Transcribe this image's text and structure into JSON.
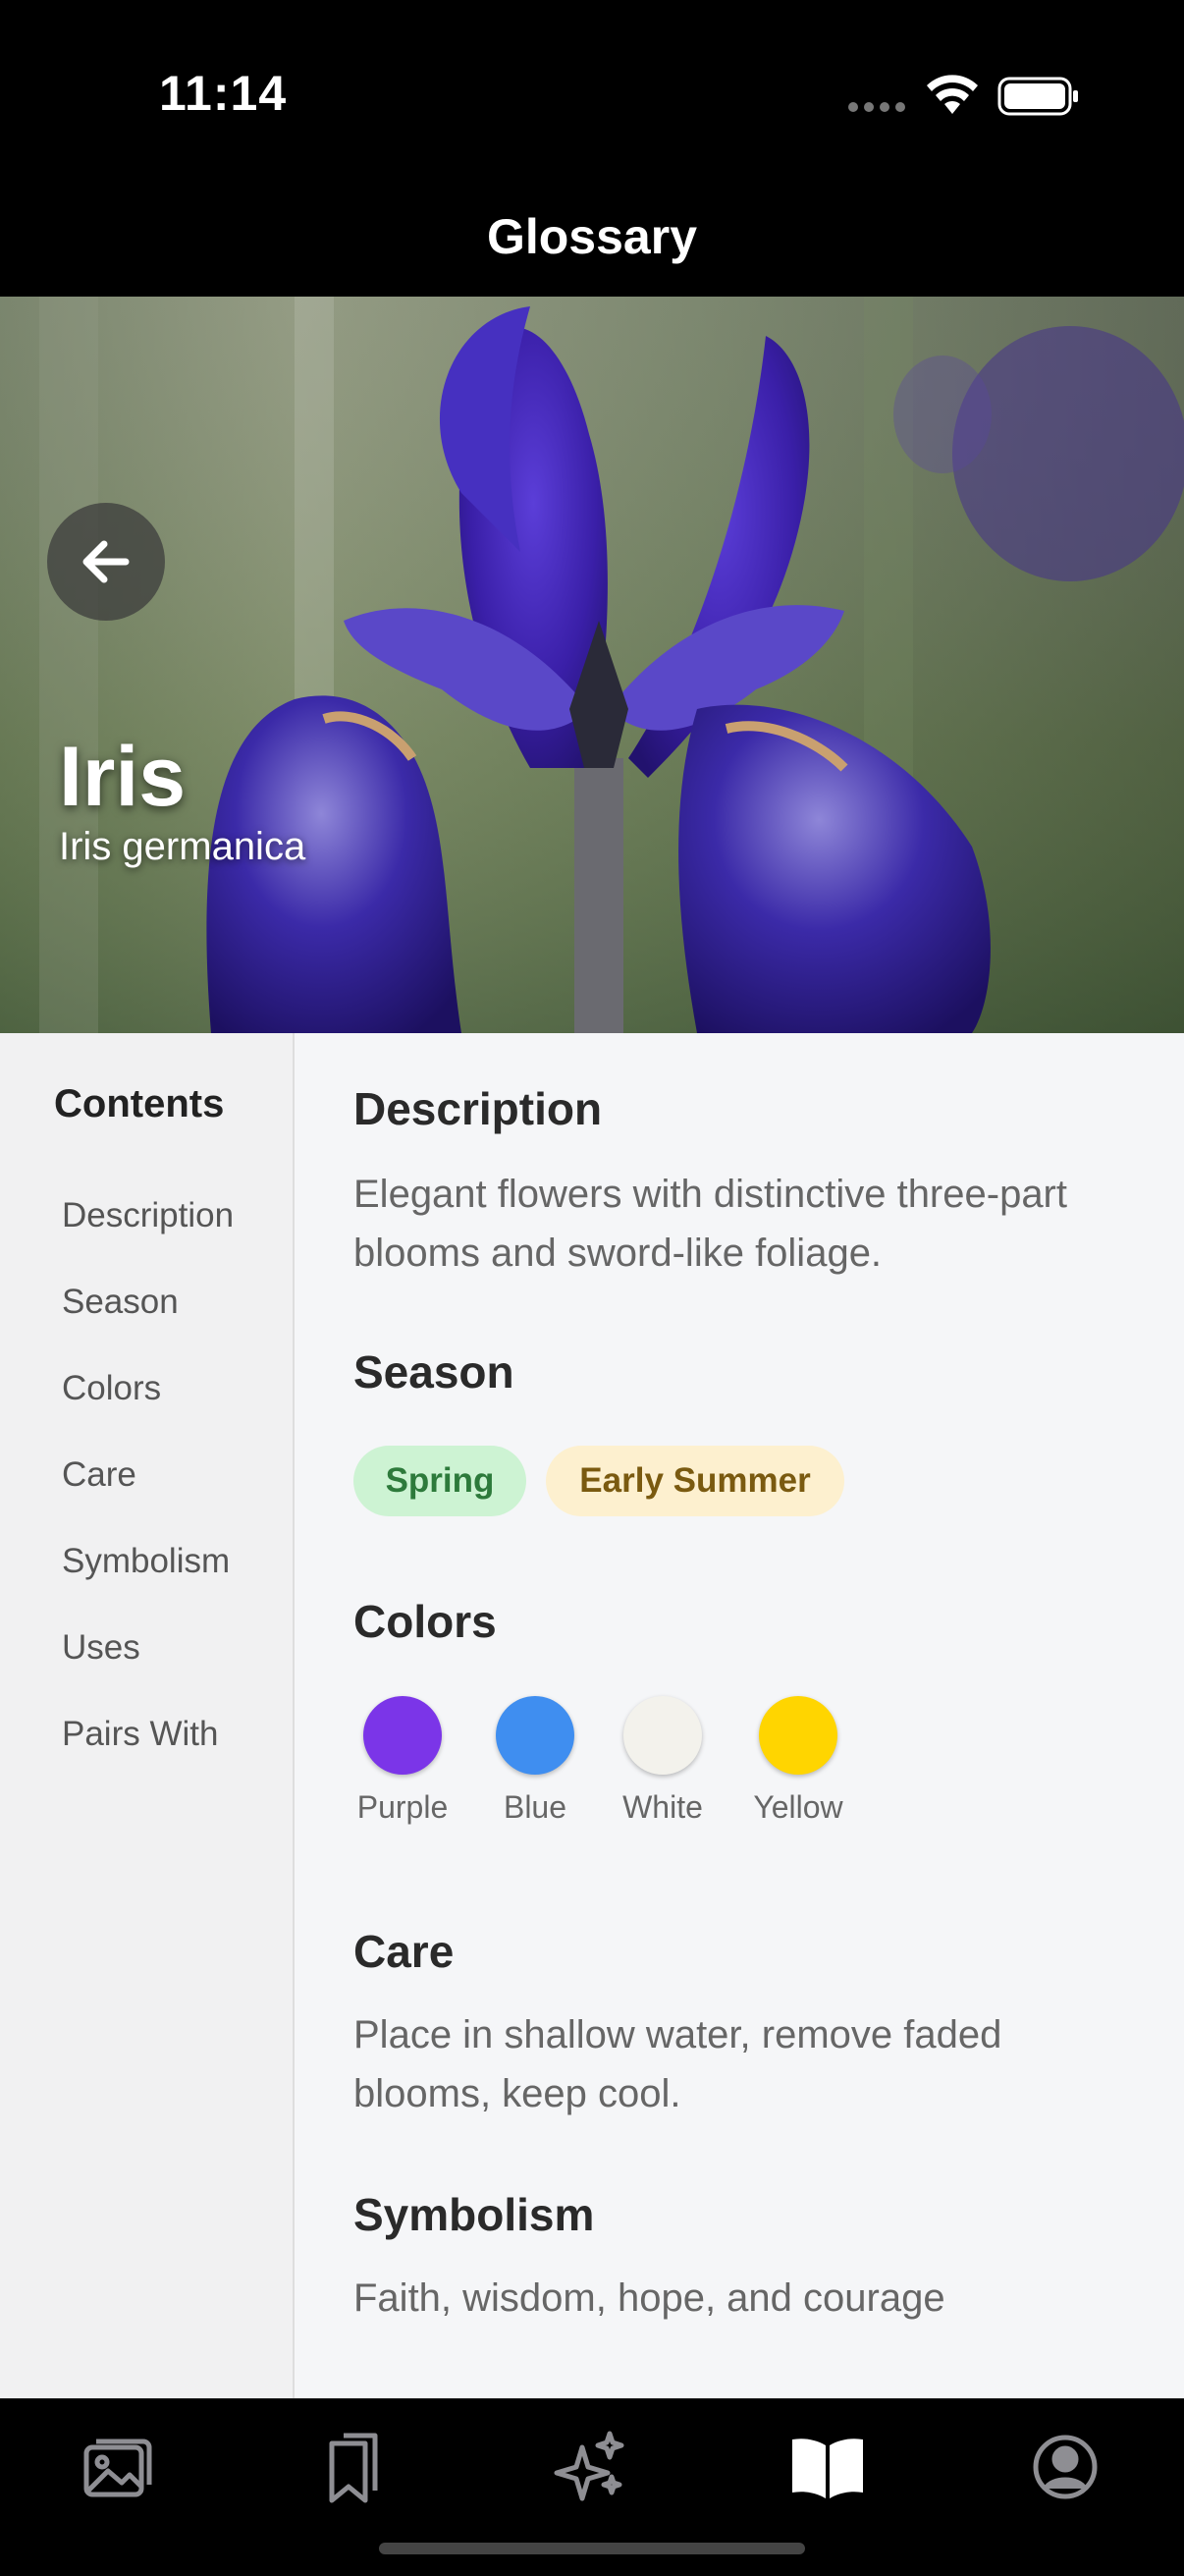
{
  "status": {
    "time": "11:14"
  },
  "header": {
    "title": "Glossary"
  },
  "hero": {
    "name": "Iris",
    "scientific_name": "Iris germanica"
  },
  "toc": {
    "title": "Contents",
    "items": [
      "Description",
      "Season",
      "Colors",
      "Care",
      "Symbolism",
      "Uses",
      "Pairs With"
    ]
  },
  "sections": {
    "description": {
      "title": "Description",
      "text": "Elegant flowers with distinctive three-part blooms and sword-like foliage."
    },
    "season": {
      "title": "Season",
      "tags": [
        "Spring",
        "Early Summer"
      ]
    },
    "colors": {
      "title": "Colors",
      "items": [
        {
          "name": "Purple",
          "hex": "#7b35e8"
        },
        {
          "name": "Blue",
          "hex": "#3f8ef0"
        },
        {
          "name": "White",
          "hex": "#f3f2ec"
        },
        {
          "name": "Yellow",
          "hex": "#ffd500"
        }
      ]
    },
    "care": {
      "title": "Care",
      "text": "Place in shallow water, remove faded blooms, keep cool."
    },
    "symbolism": {
      "title": "Symbolism",
      "text": "Faith, wisdom, hope, and courage"
    }
  },
  "tabbar": {
    "items": [
      "gallery-icon",
      "bookmarks-icon",
      "sparkles-icon",
      "glossary-book-icon",
      "profile-icon"
    ],
    "active": "glossary-book-icon"
  },
  "theme": {
    "accent_active": "#ffffff",
    "inactive": "#8e8e93"
  }
}
